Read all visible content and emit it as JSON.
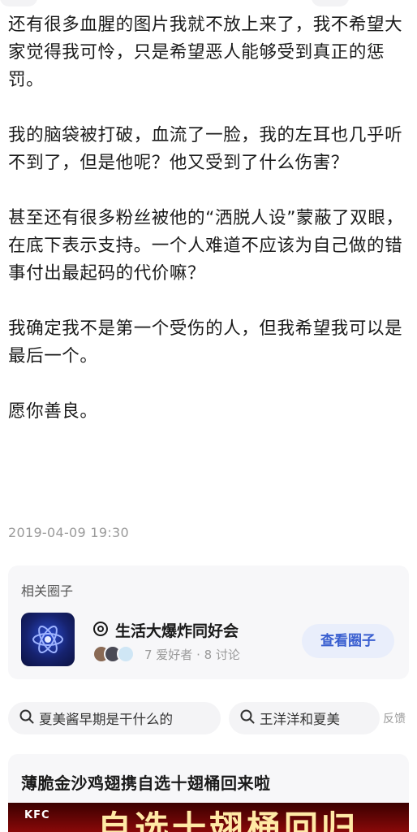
{
  "article": {
    "paragraphs": [
      "还有很多血腥的图片我就不放上来了，我不希望大家觉得我可怜，只是希望恶人能够受到真正的惩罚。",
      "我的脑袋被打破，血流了一脸，我的左耳也几乎听不到了，但是他呢？他又受到了什么伤害？",
      "甚至还有很多粉丝被他的“洒脱人设”蒙蔽了双眼，在底下表示支持。一个人难道不应该为自己做的错事付出最起码的代价嘛？",
      "我确定我不是第一个受伤的人，但我希望我可以是最后一个。",
      "愿你善良。"
    ],
    "timestamp": "2019-04-09 19:30"
  },
  "related_circle": {
    "heading": "相关圈子",
    "name": "生活大爆炸同好会",
    "name_icon": "circle-target-icon",
    "meta": "7 爱好者 · 8 讨论",
    "view_button": "查看圈子",
    "accent_color": "#3a5fd0"
  },
  "search_suggestions": {
    "chips": [
      {
        "icon": "search-icon",
        "text": "夏美酱早期是干什么的"
      },
      {
        "icon": "search-icon",
        "text": "王洋洋和夏美"
      }
    ],
    "feedback_label": "反馈"
  },
  "ad": {
    "title": "薄脆金沙鸡翅携自选十翅桶回来啦",
    "brand": "KFC",
    "banner_text": "自选十翅桶回归",
    "banner_color": "#a80c0c"
  }
}
